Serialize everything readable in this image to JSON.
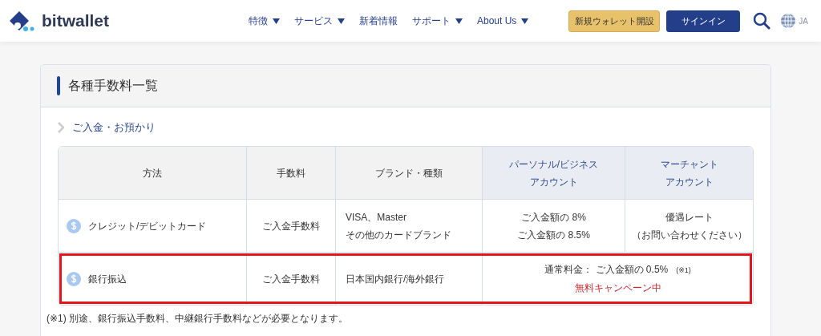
{
  "header": {
    "logo": "bitwallet",
    "nav": [
      {
        "label": "特徴",
        "dropdown": true
      },
      {
        "label": "サービス",
        "dropdown": true
      },
      {
        "label": "新着情報",
        "dropdown": false
      },
      {
        "label": "サポート",
        "dropdown": true
      },
      {
        "label": "About Us",
        "dropdown": true
      }
    ],
    "buttons": [
      {
        "label": "新規ウォレット開設",
        "kind": "primary"
      },
      {
        "label": "サインイン",
        "kind": "secondary"
      }
    ],
    "language": "JA"
  },
  "card": {
    "title": "各種手数料一覧",
    "section": "ご入金・お預かり",
    "table": {
      "columns": [
        {
          "label": "方法",
          "highlight": false
        },
        {
          "label": "手数料",
          "highlight": false
        },
        {
          "label": "ブランド・種類",
          "highlight": false
        },
        {
          "lines": [
            "パーソナル/ビジネス",
            "アカウント"
          ],
          "highlight": true
        },
        {
          "lines": [
            "マーチャント",
            "アカウント"
          ],
          "highlight": true
        }
      ],
      "rows": [
        {
          "method": "クレジット/デビットカード",
          "fee": "ご入金手数料",
          "brand": "VISA、Master\nその他のカードブランド",
          "personal": "ご入金額の 8%\nご入金額の 8.5%",
          "merchant": [
            "優遇レート",
            "（お問い合わせください）"
          ],
          "highlighted": false
        },
        {
          "method": "銀行振込",
          "fee": "ご入金手数料",
          "brand": "日本国内銀行/海外銀行",
          "combined": "通常料金： ご入金額の 0.5%",
          "note": "(※1)",
          "campaign": "無料キャンペーン中",
          "highlighted": true
        }
      ]
    },
    "footnote": "(※1) 別途、銀行振込手数料、中継銀行手数料などが必要となります。"
  }
}
